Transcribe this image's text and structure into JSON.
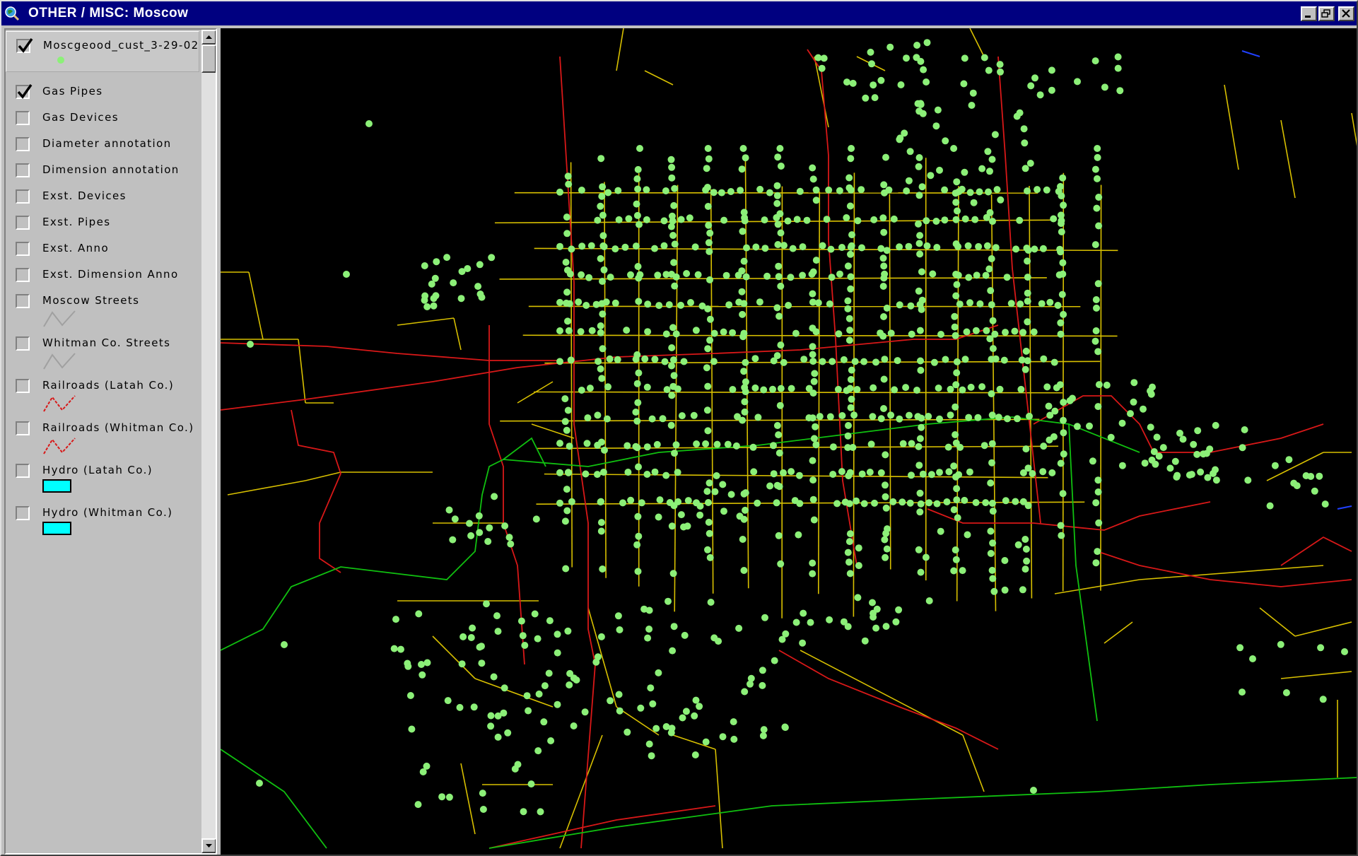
{
  "window": {
    "title": "OTHER / MISC: Moscow"
  },
  "toc": {
    "layers": [
      {
        "name": "Moscgeood_cust_3-29-02",
        "checked": true,
        "symbol": "green-point"
      },
      {
        "name": "Gas Pipes",
        "checked": true,
        "symbol": "none"
      },
      {
        "name": "Gas Devices",
        "checked": false,
        "symbol": "none"
      },
      {
        "name": "Diameter annotation",
        "checked": false,
        "symbol": "none"
      },
      {
        "name": "Dimension annotation",
        "checked": false,
        "symbol": "none"
      },
      {
        "name": "Exst. Devices",
        "checked": false,
        "symbol": "none"
      },
      {
        "name": "Exst. Pipes",
        "checked": false,
        "symbol": "none"
      },
      {
        "name": "Exst. Anno",
        "checked": false,
        "symbol": "none"
      },
      {
        "name": "Exst. Dimension Anno",
        "checked": false,
        "symbol": "none"
      },
      {
        "name": "Moscow Streets",
        "checked": false,
        "symbol": "gray-line"
      },
      {
        "name": "Whitman Co. Streets",
        "checked": false,
        "symbol": "gray-line"
      },
      {
        "name": "Railroads (Latah Co.)",
        "checked": false,
        "symbol": "red-line"
      },
      {
        "name": "Railroads (Whitman Co.)",
        "checked": false,
        "symbol": "red-line"
      },
      {
        "name": "Hydro (Latah Co.)",
        "checked": false,
        "symbol": "cyan-fill"
      },
      {
        "name": "Hydro (Whitman Co.)",
        "checked": false,
        "symbol": "cyan-fill"
      }
    ]
  },
  "colors": {
    "titlebar": "#000080",
    "map_background": "#000000",
    "customer_points": "#8cf078",
    "gas_pipes": "#d8c000",
    "railroads": "#d81818",
    "main_pipes": "#10c010",
    "hydro": "#00ffff",
    "streets_symbol": "#a0a0a0"
  },
  "icons": {
    "app": "globe-magnifier-icon",
    "minimize": "minimize-icon",
    "maximize": "restore-icon",
    "close": "close-icon",
    "check": "check-icon",
    "scroll_up": "arrow-up-icon",
    "scroll_down": "arrow-down-icon"
  }
}
